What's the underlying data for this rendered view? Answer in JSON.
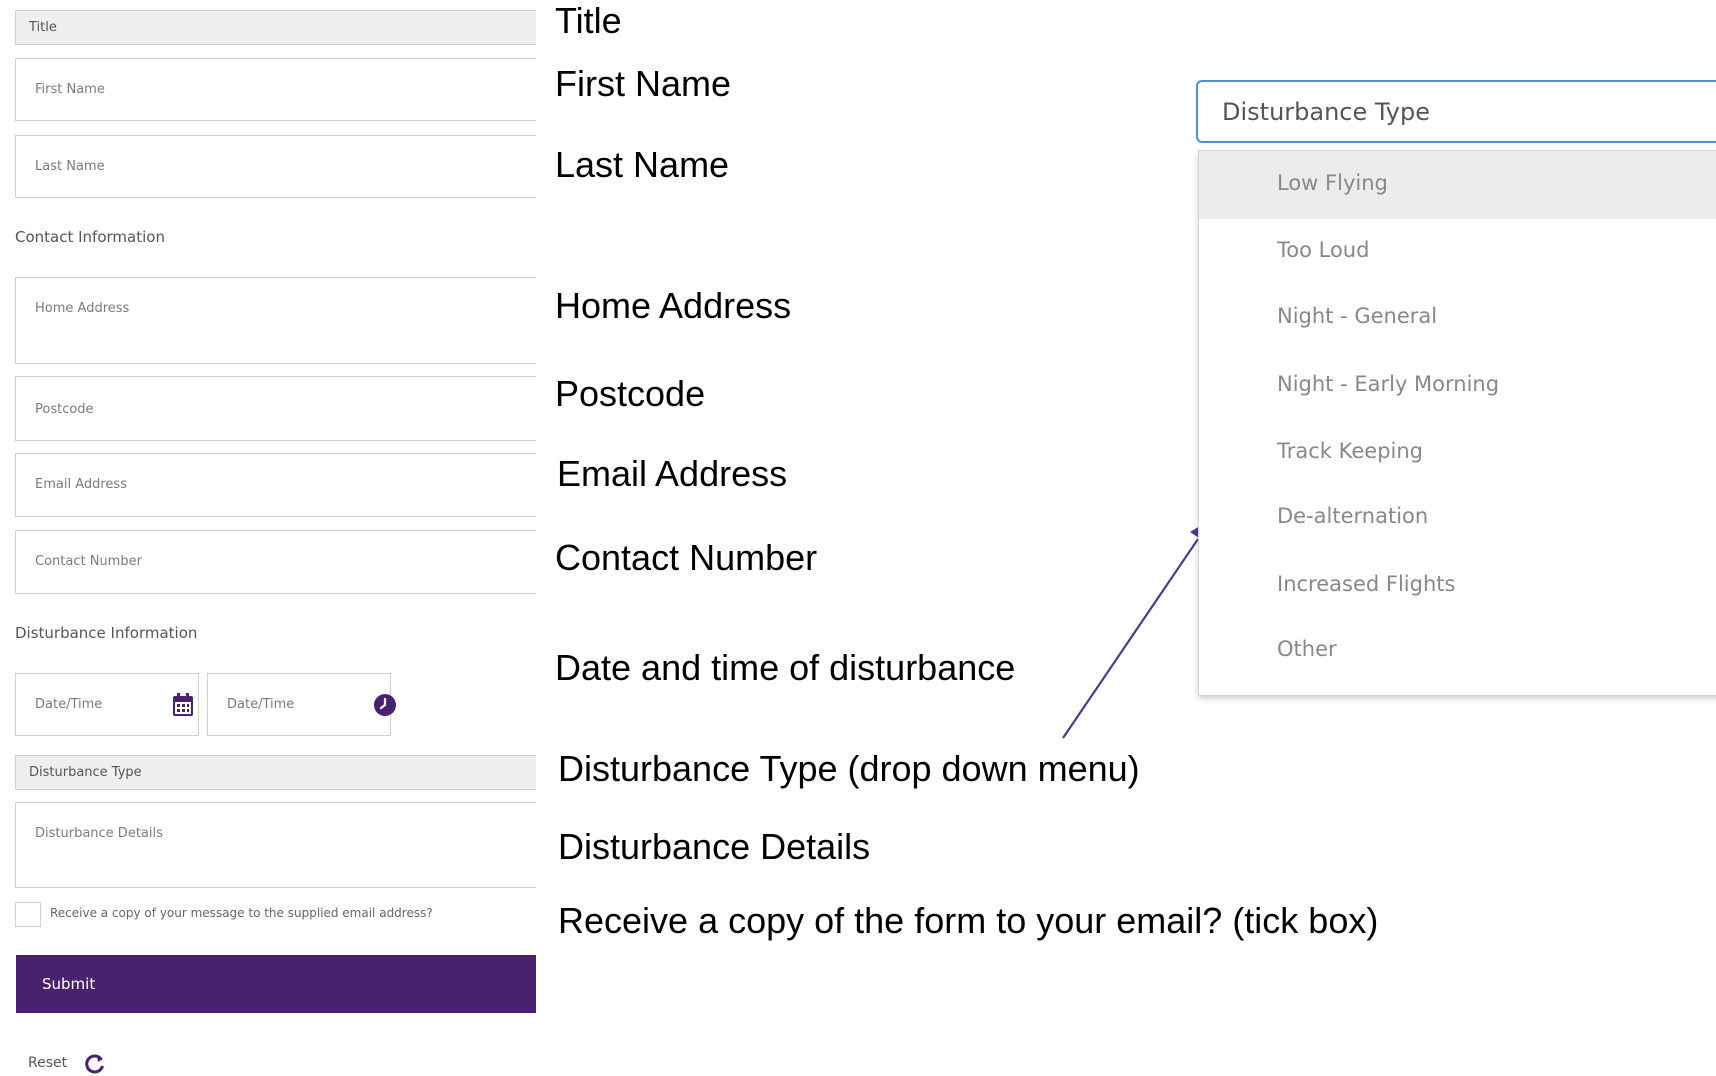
{
  "form": {
    "title_placeholder": "Title",
    "first_name_placeholder": "First Name",
    "last_name_placeholder": "Last Name",
    "contact_section_label": "Contact Information",
    "home_address_placeholder": "Home Address",
    "postcode_placeholder": "Postcode",
    "email_placeholder": "Email Address",
    "contact_number_placeholder": "Contact Number",
    "disturbance_section_label": "Disturbance Information",
    "date_placeholder": "Date/Time",
    "time_placeholder": "Date/Time",
    "disturbance_type_placeholder": "Disturbance Type",
    "disturbance_details_placeholder": "Disturbance Details",
    "copy_checkbox_label": "Receive a copy of your message to the supplied email address?",
    "copy_checkbox_checked": false,
    "submit_label": "Submit",
    "reset_label": "Reset"
  },
  "annotations": {
    "title": "Title",
    "first_name": "First Name",
    "last_name": "Last Name",
    "home_address": "Home Address",
    "postcode": "Postcode",
    "email_address": "Email Address",
    "contact_number": "Contact Number",
    "date_time": "Date and time of disturbance",
    "disturbance_type": "Disturbance Type (drop down menu)",
    "disturbance_details": "Disturbance Details",
    "receive_copy": "Receive a copy of the form to your email? (tick box)"
  },
  "dropdown": {
    "header": "Disturbance Type",
    "options": [
      "Low Flying",
      "Too Loud",
      "Night - General",
      "Night - Early Morning",
      "Track Keeping",
      "De-alternation",
      "Increased Flights",
      "Other"
    ],
    "highlighted_index": 0
  },
  "icons": {
    "calendar": "calendar-icon",
    "clock": "clock-icon",
    "reset": "refresh-icon"
  },
  "colors": {
    "accent": "#4a216e",
    "focus_border": "#4a90d9",
    "arrow": "#4a3a9a"
  }
}
